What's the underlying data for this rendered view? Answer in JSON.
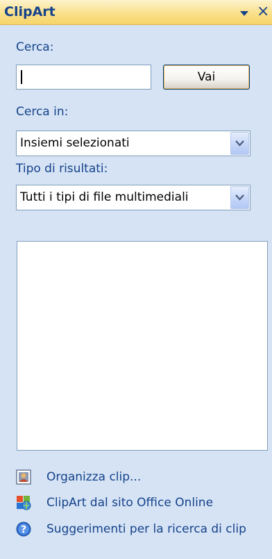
{
  "pane": {
    "title": "ClipArt",
    "close_glyph": "×",
    "menu_icon": "chevron-down-icon"
  },
  "search": {
    "label": "Cerca:",
    "value": "",
    "go_button": "Vai"
  },
  "search_in": {
    "label": "Cerca in:",
    "selected": "Insiemi selezionati"
  },
  "result_type": {
    "label": "Tipo di risultati:",
    "selected": "Tutti i tipi di file multimediali"
  },
  "links": [
    {
      "label": "Organizza clip...",
      "icon": "organizer-icon"
    },
    {
      "label": "ClipArt dal sito Office Online",
      "icon": "office-online-icon"
    },
    {
      "label": "Suggerimenti per la ricerca di clip",
      "icon": "help-icon"
    }
  ],
  "colors": {
    "title_text": "#15428b",
    "pane_background": "#d5e3f4",
    "header_gradient": "#f9e08a",
    "link_text": "#15428b"
  }
}
